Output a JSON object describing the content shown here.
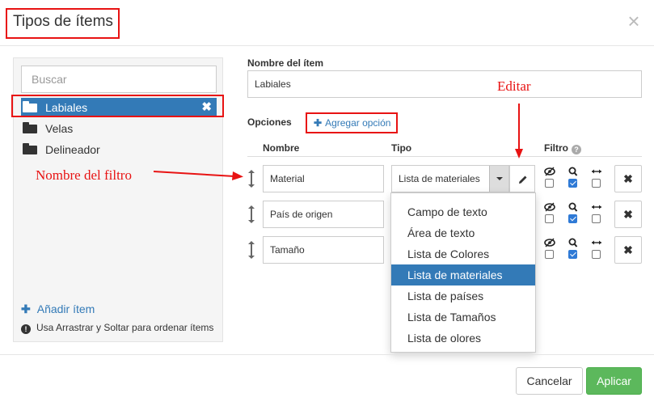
{
  "dialog": {
    "title": "Tipos de ítems"
  },
  "sidebar": {
    "search_placeholder": "Buscar",
    "items": [
      {
        "label": "Labiales",
        "active": true
      },
      {
        "label": "Velas",
        "active": false
      },
      {
        "label": "Delineador",
        "active": false
      }
    ],
    "add_item_label": "Añadir ítem",
    "hint": "Usa Arrastrar y Soltar para ordenar ítems"
  },
  "form": {
    "item_name_label": "Nombre del ítem",
    "item_name_value": "Labiales",
    "options_label": "Opciones",
    "add_option_label": "Agregar opción",
    "columns": {
      "name": "Nombre",
      "type": "Tipo",
      "filter": "Filtro"
    },
    "options": [
      {
        "name": "Material",
        "type": "Lista de materiales",
        "visible": false,
        "searchable": true,
        "range": false
      },
      {
        "name": "País de origen",
        "type": "",
        "visible": false,
        "searchable": true,
        "range": false
      },
      {
        "name": "Tamaño",
        "type": "",
        "visible": false,
        "searchable": true,
        "range": false
      }
    ]
  },
  "type_dropdown": {
    "selected": "Lista de materiales",
    "options": [
      "Campo de texto",
      "Área de texto",
      "Lista de Colores",
      "Lista de materiales",
      "Lista de países",
      "Lista de Tamaños",
      "Lista de olores"
    ]
  },
  "annotations": {
    "edit": "Editar",
    "filter_name": "Nombre del filtro"
  },
  "footer": {
    "cancel_label": "Cancelar",
    "apply_label": "Aplicar"
  },
  "colors": {
    "primary": "#337ab7",
    "success": "#5cb85c",
    "annotation": "#e81313",
    "checkbox": "#2f7ad6"
  }
}
